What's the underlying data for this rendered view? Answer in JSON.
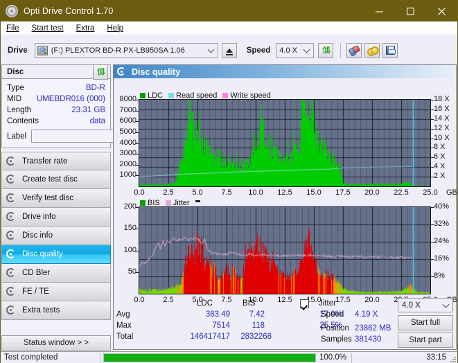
{
  "window": {
    "title": "Opti Drive Control 1.70",
    "icon": "disc-icon",
    "minimize": "minimize-icon",
    "maximize": "maximize-icon",
    "close": "close-icon",
    "titlebar_color": "#6b5c10"
  },
  "menu": [
    {
      "label": "File",
      "mnemonic": "F"
    },
    {
      "label": "Start test",
      "mnemonic": "S"
    },
    {
      "label": "Extra",
      "mnemonic": "x"
    },
    {
      "label": "Help",
      "mnemonic": "H"
    }
  ],
  "toolbar": {
    "drive_label": "Drive",
    "drive_value": "(F:)   PLEXTOR BD-R  PX-LB950SA 1.06",
    "drive_icon": "drive-icon",
    "eject_icon": "eject-icon",
    "speed_label": "Speed",
    "speed_value": "4.0 X",
    "refresh_icon": "refresh-icon",
    "eraser_icon": "eraser-icon",
    "tools_icon": "gold-rings-icon",
    "save_icon": "floppy-save-icon"
  },
  "disc_panel": {
    "title": "Disc",
    "refresh_icon": "refresh-icon",
    "rows": [
      {
        "key": "Type",
        "value": "BD-R"
      },
      {
        "key": "MID",
        "value": "UMEBDR016 (000)"
      },
      {
        "key": "Length",
        "value": "23.31 GB"
      },
      {
        "key": "Contents",
        "value": "data"
      }
    ],
    "label_key": "Label",
    "label_value": "",
    "label_placeholder": "",
    "disc_button_icon": "disc-icon"
  },
  "nav": {
    "items": [
      {
        "label": "Transfer rate",
        "icon": "disc-transfer-icon",
        "active": false
      },
      {
        "label": "Create test disc",
        "icon": "disc-create-icon",
        "active": false
      },
      {
        "label": "Verify test disc",
        "icon": "disc-verify-icon",
        "active": false
      },
      {
        "label": "Drive info",
        "icon": "disc-drive-icon",
        "active": false
      },
      {
        "label": "Disc info",
        "icon": "disc-info-icon",
        "active": false
      },
      {
        "label": "Disc quality",
        "icon": "disc-quality-icon",
        "active": true
      },
      {
        "label": "CD Bler",
        "icon": "disc-bler-icon",
        "active": false
      },
      {
        "label": "FE / TE",
        "icon": "disc-fete-icon",
        "active": false
      },
      {
        "label": "Extra tests",
        "icon": "disc-extra-icon",
        "active": false
      }
    ]
  },
  "status_window_button": "Status window > >",
  "content": {
    "header_title": "Disc quality",
    "header_icon": "disc-quality-icon"
  },
  "stats": {
    "col_ldc": "LDC",
    "col_bis": "BIS",
    "jitter_label": "Jitter",
    "jitter_checked": true,
    "rows": [
      {
        "key": "Avg",
        "ldc": "383.49",
        "bis": "7.42",
        "jitter": "17.9%"
      },
      {
        "key": "Max",
        "ldc": "7514",
        "bis": "118",
        "jitter": "25.5%"
      },
      {
        "key": "Total",
        "ldc": "146417417",
        "bis": "2832268",
        "jitter": ""
      }
    ],
    "speed_key": "Speed",
    "speed_value": "4.19 X",
    "position_key": "Position",
    "position_value": "23862 MB",
    "samples_key": "Samples",
    "samples_value": "381430",
    "speed_select": "4.0 X",
    "start_full": "Start full",
    "start_part": "Start part"
  },
  "statusbar": {
    "message": "Test completed",
    "percent_label": "100.0%",
    "percent": 100,
    "time": "33:15",
    "bar_color": "#12ae12"
  },
  "chart_data": [
    {
      "id": "ldc-chart",
      "type": "area",
      "title": "",
      "xlabel": "GB",
      "ylabel": "",
      "y2label": "X",
      "xlim": [
        0,
        25
      ],
      "ylim": [
        0,
        8000
      ],
      "y2lim": [
        0,
        18
      ],
      "grid": true,
      "xticks": [
        0.0,
        2.5,
        5.0,
        7.5,
        10.0,
        12.5,
        15.0,
        17.5,
        20.0,
        22.5,
        25.0
      ],
      "xticklabels": [
        "0.0",
        "2.5",
        "5.0",
        "7.5",
        "10.0",
        "12.5",
        "15.0",
        "17.5",
        "20.0",
        "22.5",
        "25.0"
      ],
      "yticks": [
        1000,
        2000,
        3000,
        4000,
        5000,
        6000,
        7000,
        8000
      ],
      "yticklabels": [
        "1000",
        "2000",
        "3000",
        "4000",
        "5000",
        "6000",
        "7000",
        "8000"
      ],
      "y2ticks": [
        2,
        4,
        6,
        8,
        10,
        12,
        14,
        16,
        18
      ],
      "y2ticklabels": [
        "2 X",
        "4 X",
        "6 X",
        "8 X",
        "10 X",
        "12 X",
        "14 X",
        "16 X",
        "18 X"
      ],
      "legend": [
        {
          "name": "LDC",
          "color": "#00a000"
        },
        {
          "name": "Read speed",
          "color": "#7fd4f2"
        },
        {
          "name": "Write speed",
          "color": "#ff7fe0"
        }
      ],
      "legend_position": "top-left",
      "marker_lines": [
        {
          "x": 23.5,
          "color": "#45d8ef"
        }
      ],
      "series": [
        {
          "name": "LDC",
          "color": "#00cc00",
          "kind": "area",
          "x": [
            0.0,
            0.3,
            0.6,
            0.9,
            1.2,
            1.5,
            1.8,
            2.1,
            2.4,
            2.7,
            3.0,
            3.2,
            3.4,
            3.6,
            3.8,
            4.0,
            4.2,
            4.35,
            4.45,
            4.6,
            4.8,
            5.0,
            5.2,
            5.3,
            5.4,
            5.5,
            5.7,
            5.9,
            6.1,
            6.3,
            6.5,
            6.7,
            6.9,
            7.1,
            7.3,
            7.5,
            7.7,
            7.9,
            8.1,
            8.3,
            8.5,
            8.7,
            8.9,
            9.1,
            9.3,
            9.5,
            9.7,
            9.9,
            10.1,
            10.3,
            10.5,
            10.6,
            10.8,
            11.0,
            11.2,
            11.4,
            11.6,
            11.8,
            12.0,
            12.3,
            12.6,
            12.9,
            13.2,
            13.5,
            13.8,
            14.0,
            14.2,
            14.4,
            14.6,
            14.8,
            15.0,
            15.2,
            15.5,
            15.8,
            16.0,
            16.3,
            16.6,
            16.9,
            17.2,
            17.5,
            17.7,
            18.0,
            18.5,
            19.0,
            19.5,
            20.0,
            20.5,
            21.0,
            21.5,
            22.0,
            22.5,
            23.0,
            23.4,
            23.6,
            24.0,
            24.5,
            25.0
          ],
          "y": [
            160,
            150,
            140,
            150,
            160,
            150,
            140,
            150,
            160,
            200,
            420,
            900,
            1700,
            2600,
            3600,
            4700,
            5600,
            7300,
            5300,
            4200,
            5400,
            4500,
            7250,
            4300,
            4600,
            3700,
            3500,
            3200,
            3000,
            2700,
            2500,
            2400,
            3500,
            2200,
            2600,
            2000,
            2500,
            2000,
            2100,
            1900,
            2000,
            1700,
            2100,
            1800,
            2300,
            2600,
            3600,
            3900,
            4200,
            4300,
            7550,
            5200,
            4200,
            3900,
            3600,
            3400,
            3300,
            3000,
            2600,
            2400,
            2300,
            2800,
            3000,
            3400,
            4200,
            9400,
            8700,
            9000,
            8200,
            7600,
            6500,
            5200,
            4200,
            3400,
            3600,
            2600,
            2800,
            2100,
            1600,
            300,
            180,
            200,
            180,
            190,
            180,
            190,
            180,
            190,
            180,
            200,
            240,
            420,
            90,
            60,
            60,
            60
          ]
        },
        {
          "name": "Read speed",
          "color": "#9fe4fb",
          "kind": "line",
          "x": [
            0.0,
            0.6,
            1.5,
            2.5,
            3.5,
            4.5,
            5.5,
            6.5,
            7.5,
            8.5,
            9.5,
            10.5,
            11.5,
            12.5,
            13.5,
            14.5,
            15.5,
            16.5,
            17.5,
            18.5,
            19.5,
            20.5,
            21.5,
            22.5,
            23.4
          ],
          "y_x_units": [
            1.95,
            2.05,
            2.2,
            2.35,
            2.5,
            2.6,
            2.7,
            2.8,
            2.9,
            3.0,
            3.1,
            3.15,
            3.25,
            3.3,
            3.4,
            3.45,
            3.5,
            3.6,
            3.9,
            3.95,
            3.95,
            4.0,
            4.02,
            4.05,
            4.1
          ]
        }
      ]
    },
    {
      "id": "bis-chart",
      "type": "area",
      "title": "",
      "xlabel": "GB",
      "ylabel": "",
      "y2label": "%",
      "xlim": [
        0,
        25
      ],
      "ylim": [
        0,
        200
      ],
      "y2lim": [
        0,
        40
      ],
      "grid": true,
      "xticks": [
        0.0,
        2.5,
        5.0,
        7.5,
        10.0,
        12.5,
        15.0,
        17.5,
        20.0,
        22.5,
        25.0
      ],
      "xticklabels": [
        "0.0",
        "2.5",
        "5.0",
        "7.5",
        "10.0",
        "12.5",
        "15.0",
        "17.5",
        "20.0",
        "22.5",
        "25.0"
      ],
      "yticks": [
        50,
        100,
        150,
        200
      ],
      "yticklabels": [
        "50",
        "100",
        "150",
        "200"
      ],
      "y2ticks": [
        8,
        16,
        24,
        32,
        40
      ],
      "y2ticklabels": [
        "8%",
        "16%",
        "24%",
        "32%",
        "40%"
      ],
      "legend": [
        {
          "name": "BIS",
          "color": "#00a000"
        },
        {
          "name": "Jitter",
          "color": "#e3a8d8"
        }
      ],
      "legend_position": "top-left",
      "marker_lines": [
        {
          "x": 23.5,
          "color": "#45d8ef"
        }
      ],
      "series": [
        {
          "name": "BIS",
          "color": "#e00000",
          "color_mid": "#ff9000",
          "color_low": "#7ad400",
          "kind": "area",
          "x": [
            0.0,
            0.3,
            0.6,
            0.9,
            1.2,
            1.5,
            1.8,
            2.1,
            2.4,
            2.7,
            3.0,
            3.3,
            3.6,
            3.8,
            4.0,
            4.2,
            4.4,
            4.6,
            4.8,
            5.0,
            5.2,
            5.4,
            5.6,
            5.8,
            6.0,
            6.2,
            6.4,
            6.6,
            6.8,
            7.0,
            7.2,
            7.4,
            7.6,
            7.8,
            8.0,
            8.2,
            8.4,
            8.6,
            8.8,
            9.0,
            9.2,
            9.4,
            9.6,
            9.8,
            10.0,
            10.2,
            10.4,
            10.6,
            10.8,
            11.0,
            11.2,
            11.4,
            11.6,
            11.8,
            12.0,
            12.3,
            12.6,
            12.9,
            13.2,
            13.5,
            13.8,
            14.0,
            14.2,
            14.4,
            14.6,
            14.8,
            15.0,
            15.3,
            15.6,
            16.0,
            16.4,
            16.8,
            17.2,
            17.5,
            17.8,
            18.2,
            18.6,
            19.0,
            19.5,
            20.0,
            20.5,
            21.0,
            21.5,
            22.0,
            22.5,
            23.0,
            23.3,
            23.5,
            24.0,
            24.5,
            25.0
          ],
          "y": [
            10,
            9,
            8,
            9,
            10,
            9,
            8,
            9,
            11,
            13,
            16,
            20,
            30,
            55,
            75,
            95,
            88,
            102,
            80,
            118,
            96,
            104,
            66,
            80,
            60,
            55,
            58,
            48,
            25,
            40,
            48,
            72,
            52,
            40,
            56,
            42,
            40,
            36,
            30,
            70,
            86,
            92,
            80,
            96,
            108,
            126,
            100,
            96,
            88,
            78,
            70,
            66,
            62,
            56,
            50,
            46,
            42,
            44,
            48,
            56,
            64,
            96,
            118,
            108,
            126,
            100,
            90,
            60,
            48,
            40,
            44,
            30,
            20,
            12,
            8,
            6,
            5,
            5,
            4,
            4,
            5,
            4,
            5,
            5,
            6,
            14,
            22,
            10,
            3,
            3,
            3
          ]
        },
        {
          "name": "Jitter",
          "color": "#e6b4de",
          "kind": "line",
          "x": [
            0.0,
            0.2,
            0.4,
            0.6,
            0.8,
            1.0,
            1.2,
            1.4,
            1.6,
            1.8,
            2.0,
            2.2,
            2.4,
            2.6,
            2.8,
            3.0,
            3.2,
            3.4,
            3.6,
            3.8,
            4.0,
            4.2,
            4.4,
            4.6,
            4.8,
            5.0,
            5.2,
            5.4,
            5.6,
            5.8,
            6.0,
            6.3,
            6.6,
            7.0,
            7.4,
            7.8,
            8.2,
            8.6,
            9.0,
            9.4,
            9.8,
            10.2,
            10.6,
            11.0,
            11.5,
            12.0,
            12.5,
            13.0,
            13.5,
            14.0,
            14.5,
            15.0,
            15.5,
            16.0,
            16.5,
            17.0,
            17.5,
            18.0,
            18.5,
            19.0,
            19.5,
            20.0,
            20.5,
            21.0,
            21.5,
            22.0,
            22.5,
            23.0,
            23.4
          ],
          "y_pct": [
            13.0,
            14.5,
            13.8,
            15.0,
            16.0,
            17.0,
            18.5,
            22.0,
            23.5,
            21.0,
            24.5,
            22.0,
            25.0,
            23.0,
            25.5,
            25.5,
            24.0,
            25.5,
            24.5,
            25.5,
            25.5,
            24.5,
            25.5,
            25.5,
            25.5,
            25.5,
            24.0,
            23.0,
            25.0,
            21.0,
            19.5,
            19.0,
            18.5,
            18.0,
            18.2,
            19.0,
            18.5,
            18.2,
            18.0,
            18.3,
            18.0,
            17.8,
            18.0,
            17.6,
            17.8,
            17.5,
            17.6,
            17.5,
            17.8,
            17.6,
            17.8,
            17.6,
            17.4,
            17.5,
            17.2,
            17.4,
            17.2,
            17.0,
            17.2,
            17.0,
            16.8,
            17.0,
            16.8,
            17.0,
            16.8,
            16.6,
            16.8,
            16.5,
            16.6
          ]
        }
      ]
    }
  ]
}
